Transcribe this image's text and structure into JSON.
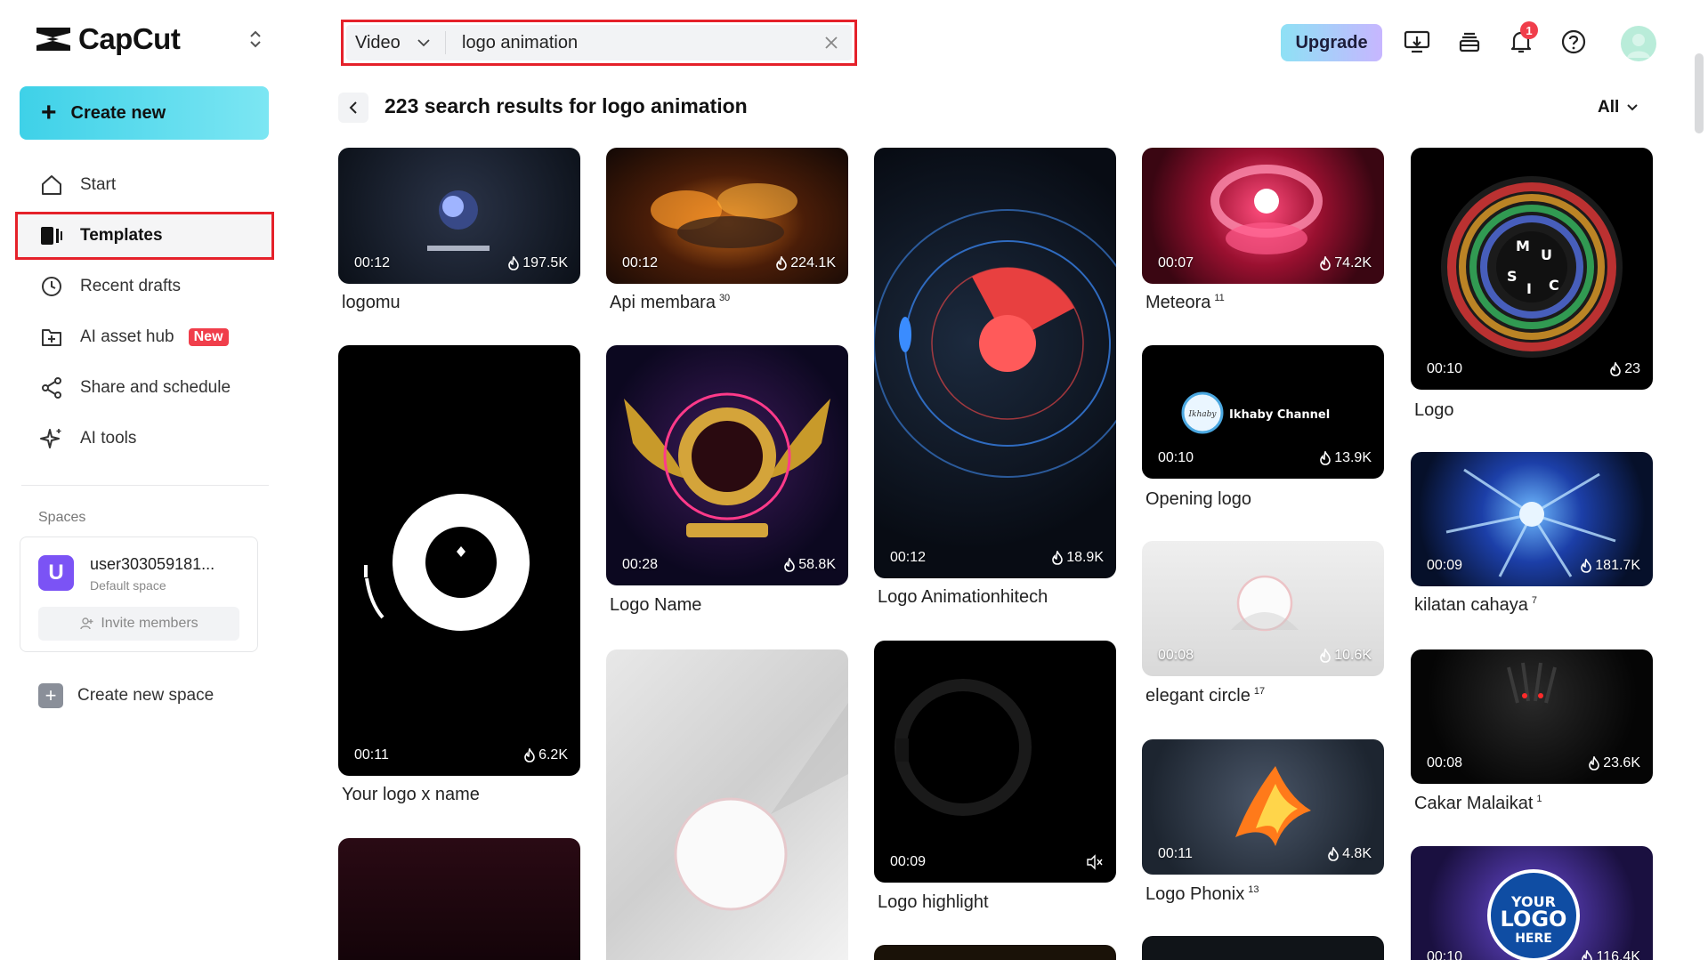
{
  "brand": {
    "name": "CapCut"
  },
  "sidebar": {
    "create_label": "Create new",
    "items": [
      {
        "label": "Start",
        "icon": "home-icon"
      },
      {
        "label": "Templates",
        "icon": "templates-icon"
      },
      {
        "label": "Recent drafts",
        "icon": "clock-icon"
      },
      {
        "label": "AI asset hub",
        "icon": "asset-hub-icon",
        "badge": "New"
      },
      {
        "label": "Share and schedule",
        "icon": "share-icon"
      },
      {
        "label": "AI tools",
        "icon": "sparkle-icon"
      }
    ],
    "spaces_label": "Spaces",
    "space": {
      "initial": "U",
      "name": "user303059181...",
      "sub": "Default space",
      "invite_label": "Invite members"
    },
    "new_space_label": "Create new space"
  },
  "search": {
    "type": "Video",
    "query": "logo animation"
  },
  "topbar": {
    "upgrade_label": "Upgrade",
    "notification_count": "1"
  },
  "results": {
    "title": "223 search results for logo animation",
    "filter": "All"
  },
  "accent_colors": {
    "highlight_red": "#e5212a",
    "create_gradient_start": "#3ed1e8",
    "badge_red": "#f03e4b",
    "space_purple": "#7b53f5"
  },
  "cards": [
    {
      "id": "c1",
      "duration": "00:12",
      "uses": "197.5K",
      "title": "logomu",
      "sup": ""
    },
    {
      "id": "c2",
      "duration": "00:11",
      "uses": "6.2K",
      "title": "Your logo x name",
      "sup": ""
    },
    {
      "id": "c3",
      "duration": "00:12",
      "uses": "224.1K",
      "title": "Api membara",
      "sup": "30"
    },
    {
      "id": "c4",
      "duration": "00:28",
      "uses": "58.8K",
      "title": "Logo Name",
      "sup": ""
    },
    {
      "id": "c5",
      "duration": "00:12",
      "uses": "18.9K",
      "title": "Logo Animationhitech",
      "sup": ""
    },
    {
      "id": "c6",
      "duration": "00:09",
      "uses": "",
      "title": "Logo highlight",
      "sup": ""
    },
    {
      "id": "c7",
      "duration": "00:07",
      "uses": "74.2K",
      "title": "Meteora",
      "sup": "11"
    },
    {
      "id": "c8",
      "duration": "00:10",
      "uses": "13.9K",
      "title": "Opening logo",
      "sup": "",
      "overlay": "Ikhaby Channel"
    },
    {
      "id": "c9",
      "duration": "00:08",
      "uses": "10.6K",
      "title": "elegant circle",
      "sup": "17"
    },
    {
      "id": "c10",
      "duration": "00:11",
      "uses": "4.8K",
      "title": "Logo Phonix",
      "sup": "13"
    },
    {
      "id": "c11",
      "duration": "00:10",
      "uses": "23",
      "title": "Logo",
      "sup": ""
    },
    {
      "id": "c12",
      "duration": "00:09",
      "uses": "181.7K",
      "title": "kilatan cahaya",
      "sup": "7"
    },
    {
      "id": "c13",
      "duration": "00:08",
      "uses": "23.6K",
      "title": "Cakar Malaikat",
      "sup": "1"
    },
    {
      "id": "c14",
      "duration": "00:10",
      "uses": "116.4K",
      "title": "",
      "sup": ""
    }
  ]
}
